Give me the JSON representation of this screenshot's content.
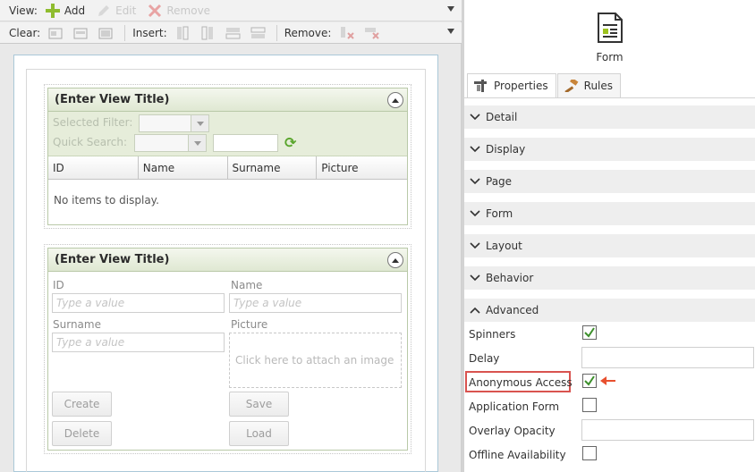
{
  "toolbar": {
    "view_label": "View:",
    "add_label": "Add",
    "edit_label": "Edit",
    "remove_label": "Remove",
    "clear_label": "Clear:",
    "insert_label": "Insert:",
    "remove2_label": "Remove:"
  },
  "list_view": {
    "title": "(Enter View Title)",
    "selected_filter_label": "Selected Filter:",
    "quick_search_label": "Quick Search:",
    "columns": [
      "ID",
      "Name",
      "Surname",
      "Picture"
    ],
    "empty_text": "No items to display."
  },
  "item_view": {
    "title": "(Enter View Title)",
    "fields": {
      "id_label": "ID",
      "name_label": "Name",
      "surname_label": "Surname",
      "picture_label": "Picture",
      "placeholder": "Type a value",
      "attach_text": "Click here to attach an image"
    },
    "buttons": {
      "create": "Create",
      "save": "Save",
      "delete": "Delete",
      "load": "Load"
    }
  },
  "panel": {
    "caption": "Form",
    "tabs": [
      "Properties",
      "Rules"
    ],
    "sections": [
      "Detail",
      "Display",
      "Page",
      "Form",
      "Layout",
      "Behavior",
      "Advanced"
    ],
    "properties": [
      {
        "label": "Spinners",
        "type": "checkbox",
        "checked": true
      },
      {
        "label": "Delay",
        "type": "text"
      },
      {
        "label": "Anonymous Access",
        "type": "checkbox",
        "checked": true
      },
      {
        "label": "Application Form",
        "type": "checkbox",
        "checked": false
      },
      {
        "label": "Overlay Opacity",
        "type": "text"
      },
      {
        "label": "Offline Availability",
        "type": "checkbox",
        "checked": false
      }
    ]
  },
  "colors": {
    "accent_green": "#59a52c",
    "highlight_red": "#d9534f",
    "view_header": "#dfe8d2"
  }
}
